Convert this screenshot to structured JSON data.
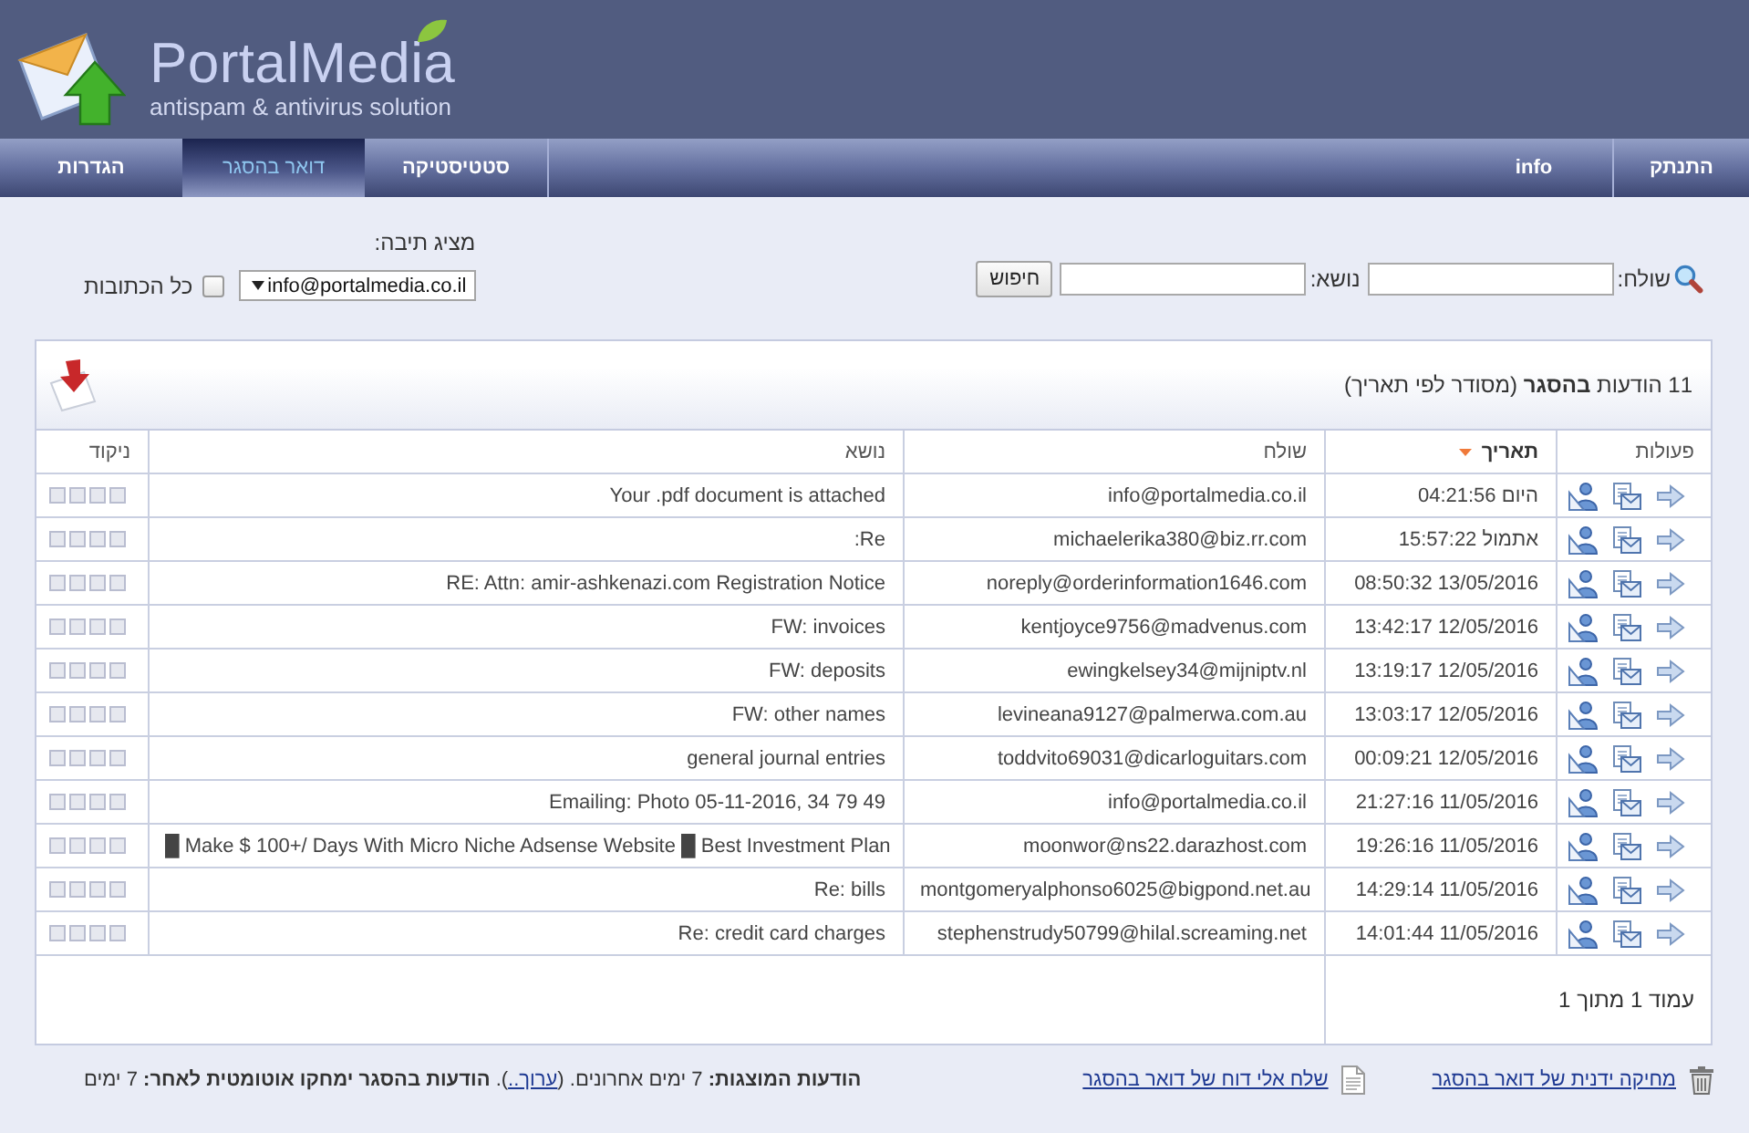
{
  "header": {
    "title": "PortalMedia",
    "subtitle": "antispam & antivirus solution"
  },
  "nav": {
    "links": [
      {
        "label": "התנתק"
      },
      {
        "label": "info"
      }
    ],
    "tabs": [
      {
        "label": "סטטיסטיקה",
        "selected": false
      },
      {
        "label": "דואר בהסגר",
        "selected": true
      },
      {
        "label": "הגדרות",
        "selected": false
      }
    ]
  },
  "search": {
    "sender_label": "שולח:",
    "subject_label": "נושא:",
    "button": "חיפוש"
  },
  "mailbox": {
    "label": "מציג תיבה:",
    "value": "info@portalmedia.co.il",
    "all_addresses": {
      "label": "כל הכתובות",
      "checked": false
    }
  },
  "panel": {
    "title": "11 הודעות **בהסגר** (מסודר לפי תאריך)",
    "columns": [
      {
        "label": "פעולות",
        "sorted": false
      },
      {
        "label": "תאריך",
        "sorted": true
      },
      {
        "label": "שולח",
        "sorted": false
      },
      {
        "label": "נושא",
        "sorted": false
      },
      {
        "label": "ניקוד",
        "sorted": false
      }
    ],
    "rows": [
      {
        "date": "היום 04:21:56",
        "sender": "info@portalmedia.co.il",
        "subject": "Your .pdf document is attached"
      },
      {
        "date": "אתמול 15:57:22",
        "sender": "michaelerika380@biz.rr.com",
        "subject": ":Re"
      },
      {
        "date": "08:50:32 13/05/2016",
        "sender": "noreply@orderinformation1646.com",
        "subject": "RE: Attn: amir-ashkenazi.com Registration Notice"
      },
      {
        "date": "13:42:17 12/05/2016",
        "sender": "kentjoyce9756@madvenus.com",
        "subject": "FW: invoices"
      },
      {
        "date": "13:19:17 12/05/2016",
        "sender": "ewingkelsey34@mijniptv.nl",
        "subject": "FW: deposits"
      },
      {
        "date": "13:03:17 12/05/2016",
        "sender": "levineana9127@palmerwa.com.au",
        "subject": "FW: other names"
      },
      {
        "date": "00:09:21 12/05/2016",
        "sender": "toddvito69031@dicarloguitars.com",
        "subject": "general journal entries"
      },
      {
        "date": "21:27:16 11/05/2016",
        "sender": "info@portalmedia.co.il",
        "subject": "Emailing: Photo 05-11-2016, 34 79 49"
      },
      {
        "date": "19:26:16 11/05/2016",
        "sender": "moonwor@ns22.darazhost.com",
        "subject": "█ Make $ 100+/ Days With Micro Niche Adsense Website █ Best Investment Plan"
      },
      {
        "date": "14:29:14 11/05/2016",
        "sender": "montgomeryalphonso6025@bigpond.net.au",
        "subject": "Re: bills"
      },
      {
        "date": "14:01:44 11/05/2016",
        "sender": "stephenstrudy50799@hilal.screaming.net",
        "subject": "Re: credit card charges"
      }
    ],
    "pager": "עמוד 1 מתוך 1"
  },
  "footer": {
    "links": [
      {
        "kind": "delete",
        "label": "מחיקה ידנית של דואר בהסגר"
      },
      {
        "kind": "report",
        "label": "שלח אלי דוח של דואר בהסגר"
      }
    ],
    "note": {
      "before": "**הודעות המוצגות:** 7 ימים אחרונים. (",
      "link": "ערוך..",
      "after": "). **הודעות בהסגר ימחקו אוטומטית לאחר:** 7 ימים"
    }
  }
}
